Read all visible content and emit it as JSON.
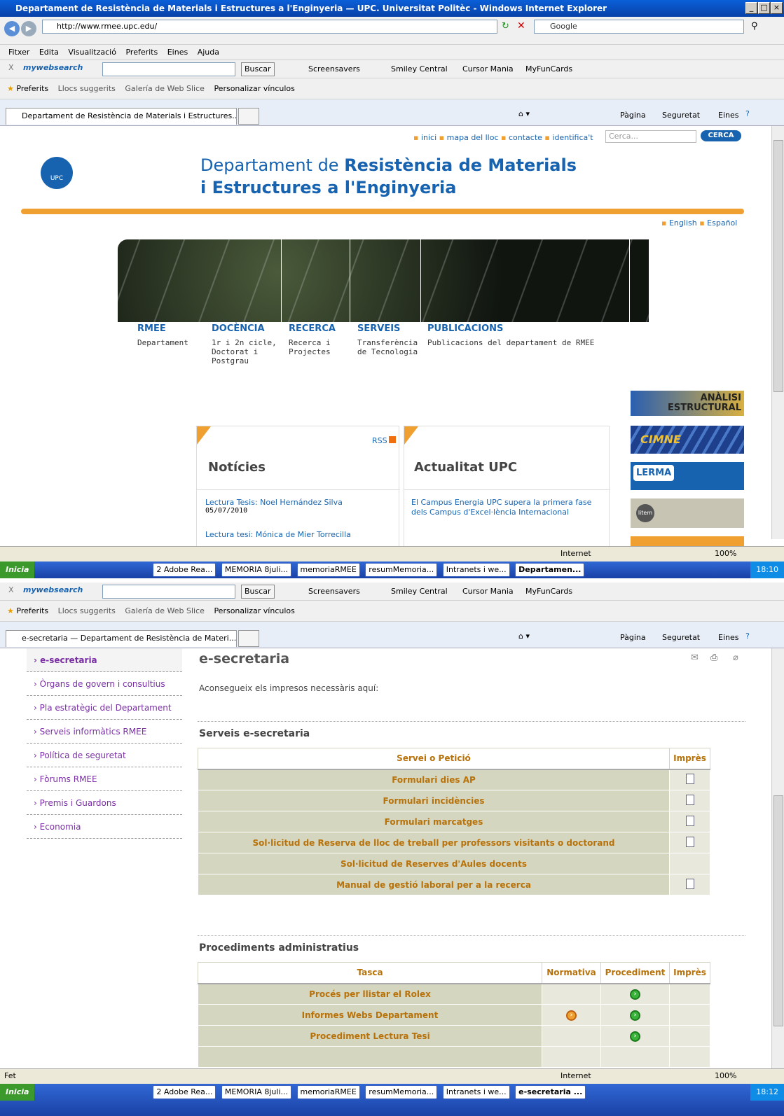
{
  "window": {
    "title": "Departament de Resistència de Materials i Estructures a l'Enginyeria — UPC. Universitat Politèc - Windows Internet Explorer"
  },
  "browser": {
    "address": "http://www.rmee.upc.edu/",
    "search_placeholder": "Google",
    "menu": [
      "Fitxer",
      "Edita",
      "Visualització",
      "Preferits",
      "Eines",
      "Ajuda"
    ],
    "toolbar": {
      "mywebsearch": "mywebsearch",
      "buscar": "Buscar",
      "screensavers": "Screensavers",
      "smiley": "Smiley Central",
      "cursor": "Cursor Mania",
      "funcards": "MyFunCards"
    },
    "favbar": {
      "preferits": "Preferits",
      "llocs": "Llocs suggerits",
      "galeria": "Galería de Web Slice",
      "personalizar": "Personalizar vínculos"
    },
    "cmdbar": {
      "pagina": "Pàgina",
      "seguretat": "Seguretat",
      "eines": "Eines"
    },
    "tab1": "Departament de Resistència de Materials i Estructures...",
    "tab2": "e-secretaria — Departament de Resistència de Materi..."
  },
  "site": {
    "topnav": [
      "inici",
      "mapa del lloc",
      "contacte",
      "identifica't"
    ],
    "search_placeholder": "Cerca...",
    "search_button": "CERCA",
    "title_line1_a": "Departament de ",
    "title_line1_b": "Resistència de Materials",
    "title_line2": "i Estructures a l'Enginyeria",
    "logo_text": "UPC",
    "languages": [
      "English",
      "Español"
    ],
    "menu": [
      {
        "title": "RMEE",
        "sub": "Departament"
      },
      {
        "title": "DOCÈNCIA",
        "sub": "1r i 2n cicle, Doctorat i Postgrau"
      },
      {
        "title": "RECERCA",
        "sub": "Recerca i Projectes"
      },
      {
        "title": "SERVEIS",
        "sub": "Transferència de Tecnologia"
      },
      {
        "title": "PUBLICACIONS",
        "sub": "Publicacions del departament de RMEE"
      }
    ],
    "rss": "RSS",
    "noticies": {
      "title": "Notícies",
      "items": [
        {
          "text": "Lectura Tesis: Noel Hernández Silva",
          "date": "05/07/2010"
        },
        {
          "text": "Lectura tesi: Mónica de Mier Torrecilla"
        }
      ]
    },
    "actualitat": {
      "title": "Actualitat UPC",
      "items": [
        "El Campus Energia UPC supera la primera fase dels Campus d'Excel·lència Internacional"
      ]
    },
    "banners": [
      "ANÀLISI ESTRUCTURAL",
      "CIMNE",
      "LERMA",
      "litem"
    ]
  },
  "status1": {
    "text": "",
    "zone": "Internet",
    "zoom": "100%"
  },
  "taskbar1": {
    "start": "Inicia",
    "buttons": [
      "2 Adobe Rea...",
      "MEMORIA 8juli...",
      "memoriaRMEE",
      "resumMemoria...",
      "Intranets i we...",
      "Departamen..."
    ],
    "clock": "18:10"
  },
  "esec": {
    "sidebar": [
      "e-secretaria",
      "Òrgans de govern i consultius",
      "Pla estratègic del Departament",
      "Serveis informàtics RMEE",
      "Política de seguretat",
      "Fòrums RMEE",
      "Premis i Guardons",
      "Economia"
    ],
    "title": "e-secretaria",
    "intro": "Aconsegueix els impresos necessàris aquí:",
    "serveis_title": "Serveis e-secretaria",
    "serveis_headers": [
      "Servei o Petició",
      "Imprès"
    ],
    "serveis_rows": [
      {
        "name": "Formulari dies AP",
        "doc": true
      },
      {
        "name": "Formulari incidències",
        "doc": true
      },
      {
        "name": "Formulari marcatges",
        "doc": true
      },
      {
        "name": "Sol·licitud de Reserva de lloc de treball per professors visitants o doctorand",
        "doc": true
      },
      {
        "name": "Sol·licitud de Reserves d'Aules docents",
        "doc": false
      },
      {
        "name": "Manual de gestió laboral per a la recerca",
        "doc": true
      }
    ],
    "proc_title": "Procediments administratius",
    "proc_headers": [
      "Tasca",
      "Normativa",
      "Procediment",
      "Imprès"
    ],
    "proc_rows": [
      {
        "name": "Procés per llistar el Rolex",
        "normativa": false,
        "procediment": true
      },
      {
        "name": "Informes Webs Departament",
        "normativa": true,
        "procediment": true
      },
      {
        "name": "Procediment Lectura Tesi",
        "normativa": false,
        "procediment": true
      },
      {
        "name": "",
        "normativa": false,
        "procediment": false
      }
    ]
  },
  "status2": {
    "text": "Fet",
    "zone": "Internet",
    "zoom": "100%"
  },
  "taskbar2": {
    "start": "Inicia",
    "buttons": [
      "2 Adobe Rea...",
      "MEMORIA 8juli...",
      "memoriaRMEE",
      "resumMemoria...",
      "Intranets i we...",
      "e-secretaria ..."
    ],
    "clock": "18:12"
  }
}
